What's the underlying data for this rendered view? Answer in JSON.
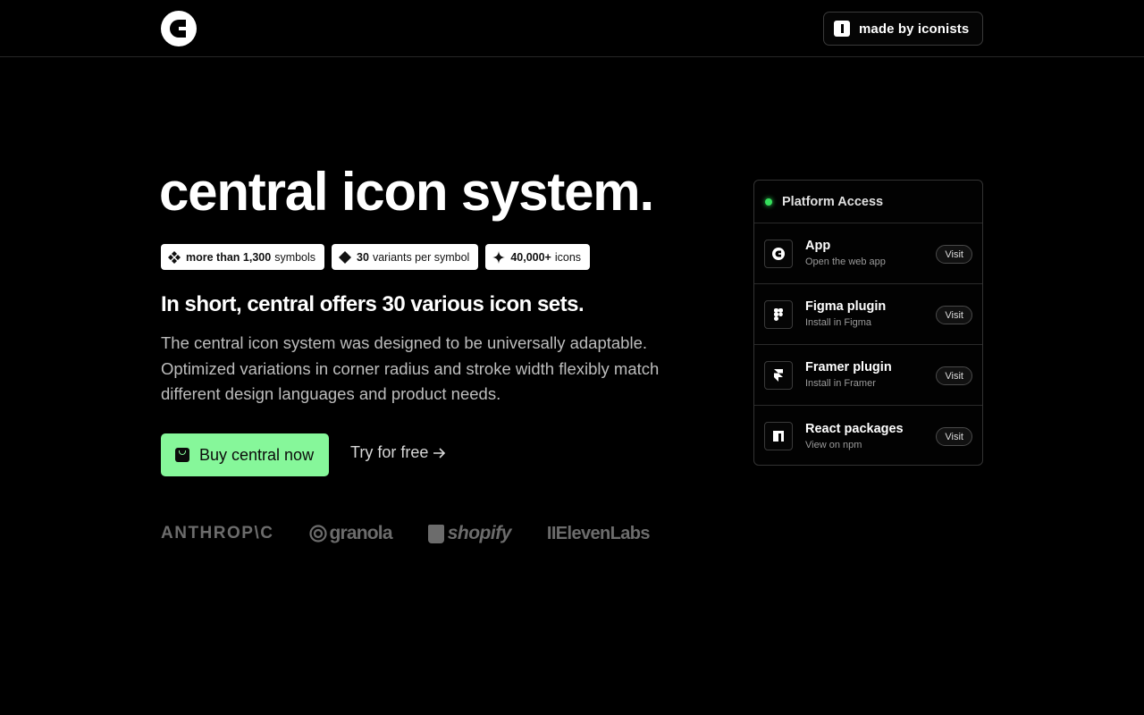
{
  "header": {
    "logo_icon": "central-logo-icon",
    "made_by_label": "made by iconists",
    "made_by_icon": "iconists-logo-icon"
  },
  "hero": {
    "title": "central icon system.",
    "pills": [
      {
        "icon": "grid-diamond-icon",
        "bold": "more than 1,300",
        "text": "symbols"
      },
      {
        "icon": "diamond-icon",
        "bold": "30",
        "text": "variants per symbol"
      },
      {
        "icon": "sparkle-icon",
        "bold": "40,000+",
        "text": "icons"
      }
    ],
    "subheading": "In short, central offers 30 various icon sets.",
    "description": "The central icon system was designed to be universally adaptable. Optimized variations in corner radius and stroke width flexibly match different design languages and product needs.",
    "buy_label": "Buy central now",
    "try_label": "Try for free",
    "accent_color": "#86f79a"
  },
  "customers": [
    "ANTHROP\\C",
    "granola",
    "shopify",
    "IIElevenLabs"
  ],
  "platform": {
    "title": "Platform Access",
    "status_color": "#35e05c",
    "items": [
      {
        "icon": "central-c-icon",
        "title": "App",
        "subtitle": "Open the web app",
        "action": "Visit"
      },
      {
        "icon": "figma-icon",
        "title": "Figma plugin",
        "subtitle": "Install in Figma",
        "action": "Visit"
      },
      {
        "icon": "framer-icon",
        "title": "Framer plugin",
        "subtitle": "Install in Framer",
        "action": "Visit"
      },
      {
        "icon": "npm-icon",
        "title": "React packages",
        "subtitle": "View on npm",
        "action": "Visit"
      }
    ]
  }
}
